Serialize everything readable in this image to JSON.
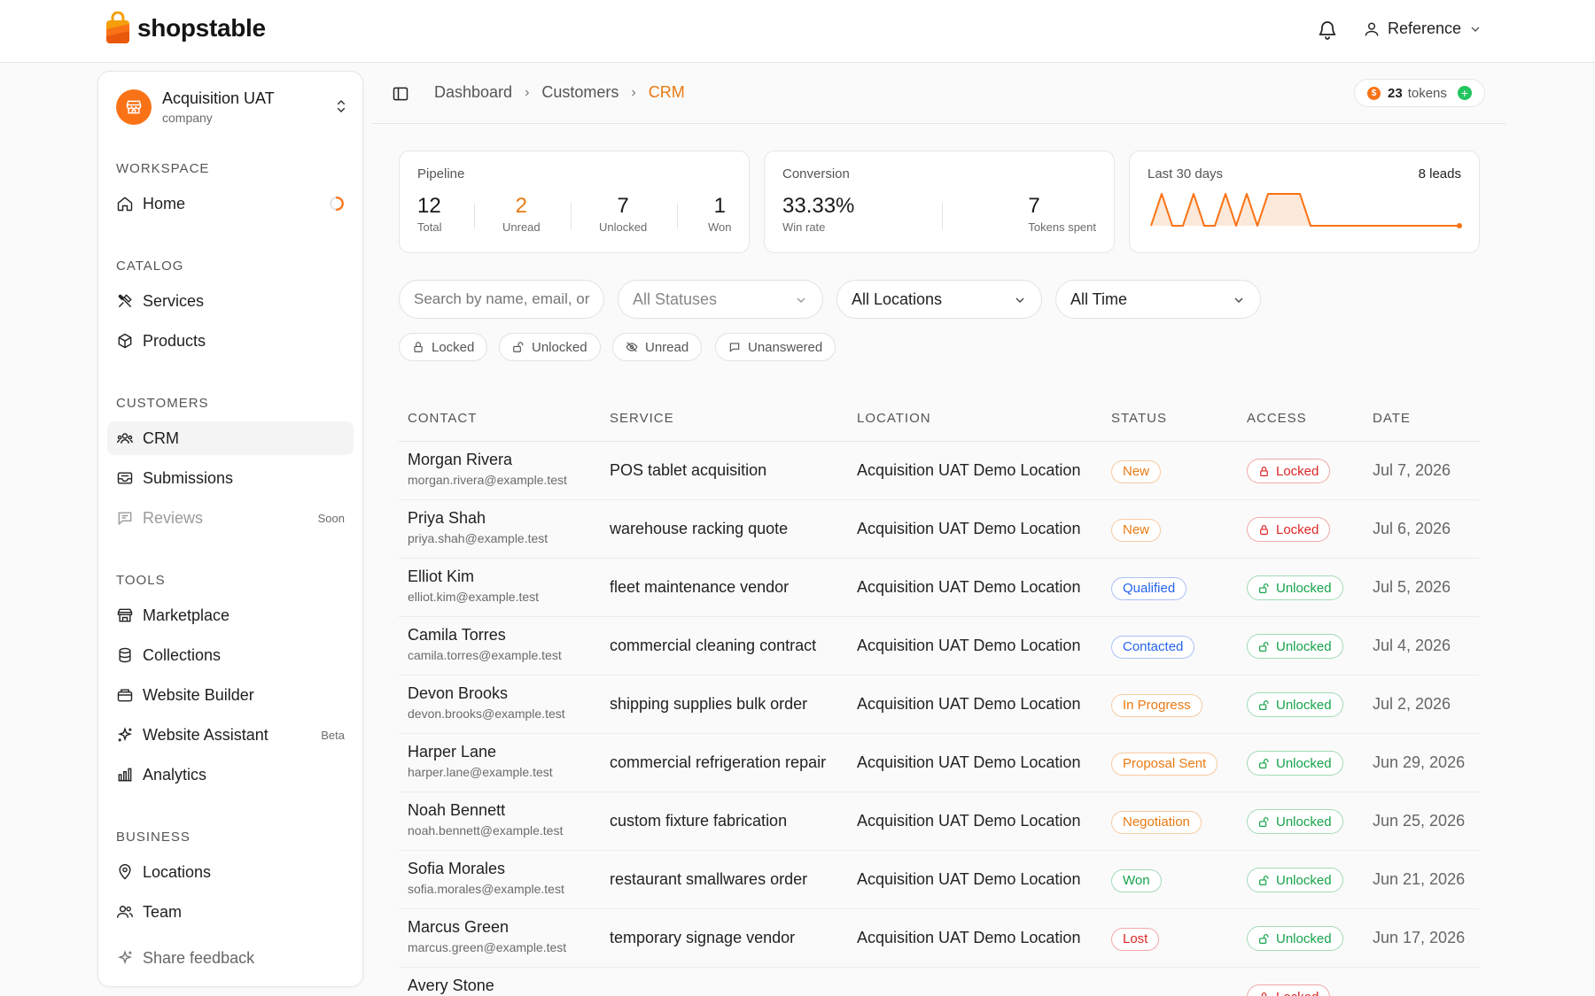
{
  "app": {
    "brand": "shopstable",
    "user_name": "Reference"
  },
  "company": {
    "name": "Acquisition UAT",
    "type": "company"
  },
  "sidebar": {
    "sections": {
      "workspace": "WORKSPACE",
      "catalog": "CATALOG",
      "customers": "CUSTOMERS",
      "tools": "TOOLS",
      "business": "BUSINESS"
    },
    "items": {
      "home": "Home",
      "services": "Services",
      "products": "Products",
      "crm": "CRM",
      "submissions": "Submissions",
      "reviews": "Reviews",
      "reviews_tag": "Soon",
      "marketplace": "Marketplace",
      "collections": "Collections",
      "website_builder": "Website Builder",
      "website_assistant": "Website Assistant",
      "website_assistant_tag": "Beta",
      "analytics": "Analytics",
      "locations": "Locations",
      "team": "Team",
      "share_feedback": "Share feedback"
    },
    "active_item": "crm"
  },
  "breadcrumb": {
    "items": [
      "Dashboard",
      "Customers"
    ],
    "current": "CRM"
  },
  "tokens": {
    "count": "23",
    "label": "tokens"
  },
  "stats": {
    "pipeline": {
      "label": "Pipeline",
      "total": "12",
      "total_label": "Total",
      "unread": "2",
      "unread_label": "Unread",
      "unlocked": "7",
      "unlocked_label": "Unlocked",
      "won": "1",
      "won_label": "Won"
    },
    "conversion": {
      "label": "Conversion",
      "win_rate": "33.33%",
      "win_rate_label": "Win rate",
      "tokens_spent": "7",
      "tokens_spent_label": "Tokens spent"
    },
    "last30": {
      "label": "Last 30 days",
      "leads": "8 leads",
      "sparkline": [
        0,
        1,
        0,
        0,
        1,
        0,
        0,
        1,
        0,
        1,
        0,
        1,
        1,
        1,
        1,
        0,
        0,
        0,
        0,
        0,
        0,
        0,
        0,
        0,
        0,
        0,
        0,
        0,
        0,
        0
      ]
    }
  },
  "filters": {
    "search_placeholder": "Search by name, email, or",
    "status": "All Statuses",
    "location": "All Locations",
    "time": "All Time",
    "chips": [
      "Locked",
      "Unlocked",
      "Unread",
      "Unanswered"
    ]
  },
  "table": {
    "columns": [
      "CONTACT",
      "SERVICE",
      "LOCATION",
      "STATUS",
      "ACCESS",
      "DATE"
    ],
    "rows": [
      {
        "name": "Morgan Rivera",
        "email": "morgan.rivera@example.test",
        "service": "POS tablet acquisition",
        "location": "Acquisition UAT Demo Location",
        "status": "New",
        "status_color": "#ea7a12",
        "access": "Locked",
        "date": "Jul 7, 2026"
      },
      {
        "name": "Priya Shah",
        "email": "priya.shah@example.test",
        "service": "warehouse racking quote",
        "location": "Acquisition UAT Demo Location",
        "status": "New",
        "status_color": "#ea7a12",
        "access": "Locked",
        "date": "Jul 6, 2026"
      },
      {
        "name": "Elliot Kim",
        "email": "elliot.kim@example.test",
        "service": "fleet maintenance vendor",
        "location": "Acquisition UAT Demo Location",
        "status": "Qualified",
        "status_color": "#2563eb",
        "access": "Unlocked",
        "date": "Jul 5, 2026"
      },
      {
        "name": "Camila Torres",
        "email": "camila.torres@example.test",
        "service": "commercial cleaning contract",
        "location": "Acquisition UAT Demo Location",
        "status": "Contacted",
        "status_color": "#2563eb",
        "access": "Unlocked",
        "date": "Jul 4, 2026"
      },
      {
        "name": "Devon Brooks",
        "email": "devon.brooks@example.test",
        "service": "shipping supplies bulk order",
        "location": "Acquisition UAT Demo Location",
        "status": "In Progress",
        "status_color": "#ea7a12",
        "access": "Unlocked",
        "date": "Jul 2, 2026"
      },
      {
        "name": "Harper Lane",
        "email": "harper.lane@example.test",
        "service": "commercial refrigeration repair",
        "location": "Acquisition UAT Demo Location",
        "status": "Proposal Sent",
        "status_color": "#ea7a12",
        "access": "Unlocked",
        "date": "Jun 29, 2026"
      },
      {
        "name": "Noah Bennett",
        "email": "noah.bennett@example.test",
        "service": "custom fixture fabrication",
        "location": "Acquisition UAT Demo Location",
        "status": "Negotiation",
        "status_color": "#ea7a12",
        "access": "Unlocked",
        "date": "Jun 25, 2026"
      },
      {
        "name": "Sofia Morales",
        "email": "sofia.morales@example.test",
        "service": "restaurant smallwares order",
        "location": "Acquisition UAT Demo Location",
        "status": "Won",
        "status_color": "#16a34a",
        "access": "Unlocked",
        "date": "Jun 21, 2026"
      },
      {
        "name": "Marcus Green",
        "email": "marcus.green@example.test",
        "service": "temporary signage vendor",
        "location": "Acquisition UAT Demo Location",
        "status": "Lost",
        "status_color": "#dc2626",
        "access": "Unlocked",
        "date": "Jun 17, 2026"
      },
      {
        "name": "Avery Stone",
        "email": "",
        "service": "",
        "location": "",
        "status": "",
        "status_color": "#888888",
        "access": "Locked",
        "date": ""
      }
    ]
  },
  "colors": {
    "accent": "#f97316",
    "locked": "#dc2626",
    "unlocked": "#16a34a"
  }
}
